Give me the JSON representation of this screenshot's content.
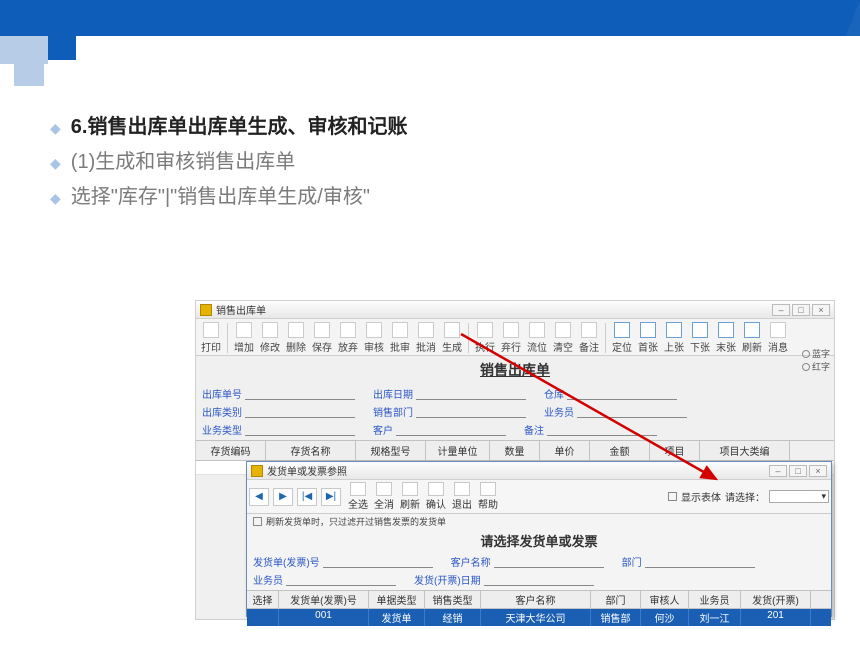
{
  "slide": {
    "title": "6.销售出库单出库单生成、审核和记账",
    "line1": "(1)生成和审核销售出库单",
    "line2": "选择\"库存\"|\"销售出库单生成/审核\""
  },
  "win1": {
    "title": "销售出库单",
    "toolbar": [
      "打印",
      "增加",
      "修改",
      "删除",
      "保存",
      "放弃",
      "审核",
      "批审",
      "批消",
      "生成",
      "执行",
      "弃行",
      "流位",
      "清空",
      "备注",
      "定位",
      "首张",
      "上张",
      "下张",
      "末张",
      "刷新",
      "消息"
    ],
    "radio1": "蓝字",
    "radio2": "红字",
    "form": {
      "r1": {
        "a": "出库单号",
        "b": "出库日期",
        "c": "仓库"
      },
      "r2": {
        "a": "出库类别",
        "b": "销售部门",
        "c": "业务员"
      },
      "r3": {
        "a": "业务类型",
        "b": "客户",
        "c": "备注"
      }
    },
    "cols": [
      "存货编码",
      "存货名称",
      "规格型号",
      "计量单位",
      "数量",
      "单价",
      "金额",
      "项目",
      "项目大类编"
    ]
  },
  "win2": {
    "title": "发货单或发票参照",
    "nav_row": [
      "上条",
      "下条",
      "首条",
      "末条",
      "全选",
      "全消",
      "刷新",
      "确认",
      "退出",
      "帮助"
    ],
    "show_header": "显示表体",
    "select_label": "请选择：",
    "select_value": "",
    "note": "刷新发货单时，只过滤开过销售发票的发货单",
    "doc_title": "请选择发货单或发票",
    "form": {
      "a": "发货单(发票)号",
      "b": "客户名称",
      "c": "部门",
      "d": "业务员",
      "e": "发货(开票)日期"
    },
    "cols": [
      "选择",
      "发货单(发票)号",
      "单据类型",
      "销售类型",
      "客户名称",
      "部门",
      "审核人",
      "业务员",
      "发货(开票)"
    ],
    "row": [
      "",
      "001",
      "发货单",
      "经销",
      "天津大华公司",
      "销售部",
      "何沙",
      "刘一江",
      "201"
    ]
  },
  "chart_data": null
}
